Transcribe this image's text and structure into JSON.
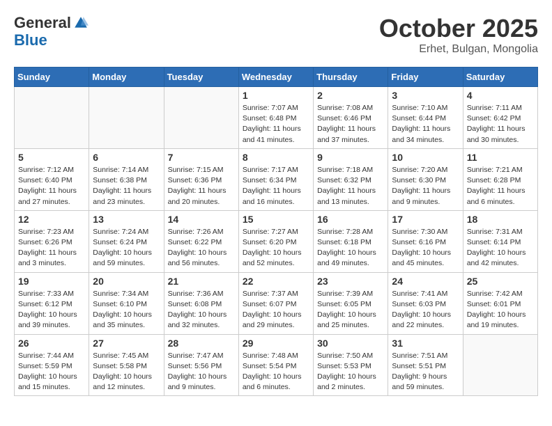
{
  "header": {
    "logo_line1": "General",
    "logo_line2": "Blue",
    "month_title": "October 2025",
    "location": "Erhet, Bulgan, Mongolia"
  },
  "weekdays": [
    "Sunday",
    "Monday",
    "Tuesday",
    "Wednesday",
    "Thursday",
    "Friday",
    "Saturday"
  ],
  "weeks": [
    [
      {
        "day": "",
        "info": ""
      },
      {
        "day": "",
        "info": ""
      },
      {
        "day": "",
        "info": ""
      },
      {
        "day": "1",
        "info": "Sunrise: 7:07 AM\nSunset: 6:48 PM\nDaylight: 11 hours\nand 41 minutes."
      },
      {
        "day": "2",
        "info": "Sunrise: 7:08 AM\nSunset: 6:46 PM\nDaylight: 11 hours\nand 37 minutes."
      },
      {
        "day": "3",
        "info": "Sunrise: 7:10 AM\nSunset: 6:44 PM\nDaylight: 11 hours\nand 34 minutes."
      },
      {
        "day": "4",
        "info": "Sunrise: 7:11 AM\nSunset: 6:42 PM\nDaylight: 11 hours\nand 30 minutes."
      }
    ],
    [
      {
        "day": "5",
        "info": "Sunrise: 7:12 AM\nSunset: 6:40 PM\nDaylight: 11 hours\nand 27 minutes."
      },
      {
        "day": "6",
        "info": "Sunrise: 7:14 AM\nSunset: 6:38 PM\nDaylight: 11 hours\nand 23 minutes."
      },
      {
        "day": "7",
        "info": "Sunrise: 7:15 AM\nSunset: 6:36 PM\nDaylight: 11 hours\nand 20 minutes."
      },
      {
        "day": "8",
        "info": "Sunrise: 7:17 AM\nSunset: 6:34 PM\nDaylight: 11 hours\nand 16 minutes."
      },
      {
        "day": "9",
        "info": "Sunrise: 7:18 AM\nSunset: 6:32 PM\nDaylight: 11 hours\nand 13 minutes."
      },
      {
        "day": "10",
        "info": "Sunrise: 7:20 AM\nSunset: 6:30 PM\nDaylight: 11 hours\nand 9 minutes."
      },
      {
        "day": "11",
        "info": "Sunrise: 7:21 AM\nSunset: 6:28 PM\nDaylight: 11 hours\nand 6 minutes."
      }
    ],
    [
      {
        "day": "12",
        "info": "Sunrise: 7:23 AM\nSunset: 6:26 PM\nDaylight: 11 hours\nand 3 minutes."
      },
      {
        "day": "13",
        "info": "Sunrise: 7:24 AM\nSunset: 6:24 PM\nDaylight: 10 hours\nand 59 minutes."
      },
      {
        "day": "14",
        "info": "Sunrise: 7:26 AM\nSunset: 6:22 PM\nDaylight: 10 hours\nand 56 minutes."
      },
      {
        "day": "15",
        "info": "Sunrise: 7:27 AM\nSunset: 6:20 PM\nDaylight: 10 hours\nand 52 minutes."
      },
      {
        "day": "16",
        "info": "Sunrise: 7:28 AM\nSunset: 6:18 PM\nDaylight: 10 hours\nand 49 minutes."
      },
      {
        "day": "17",
        "info": "Sunrise: 7:30 AM\nSunset: 6:16 PM\nDaylight: 10 hours\nand 45 minutes."
      },
      {
        "day": "18",
        "info": "Sunrise: 7:31 AM\nSunset: 6:14 PM\nDaylight: 10 hours\nand 42 minutes."
      }
    ],
    [
      {
        "day": "19",
        "info": "Sunrise: 7:33 AM\nSunset: 6:12 PM\nDaylight: 10 hours\nand 39 minutes."
      },
      {
        "day": "20",
        "info": "Sunrise: 7:34 AM\nSunset: 6:10 PM\nDaylight: 10 hours\nand 35 minutes."
      },
      {
        "day": "21",
        "info": "Sunrise: 7:36 AM\nSunset: 6:08 PM\nDaylight: 10 hours\nand 32 minutes."
      },
      {
        "day": "22",
        "info": "Sunrise: 7:37 AM\nSunset: 6:07 PM\nDaylight: 10 hours\nand 29 minutes."
      },
      {
        "day": "23",
        "info": "Sunrise: 7:39 AM\nSunset: 6:05 PM\nDaylight: 10 hours\nand 25 minutes."
      },
      {
        "day": "24",
        "info": "Sunrise: 7:41 AM\nSunset: 6:03 PM\nDaylight: 10 hours\nand 22 minutes."
      },
      {
        "day": "25",
        "info": "Sunrise: 7:42 AM\nSunset: 6:01 PM\nDaylight: 10 hours\nand 19 minutes."
      }
    ],
    [
      {
        "day": "26",
        "info": "Sunrise: 7:44 AM\nSunset: 5:59 PM\nDaylight: 10 hours\nand 15 minutes."
      },
      {
        "day": "27",
        "info": "Sunrise: 7:45 AM\nSunset: 5:58 PM\nDaylight: 10 hours\nand 12 minutes."
      },
      {
        "day": "28",
        "info": "Sunrise: 7:47 AM\nSunset: 5:56 PM\nDaylight: 10 hours\nand 9 minutes."
      },
      {
        "day": "29",
        "info": "Sunrise: 7:48 AM\nSunset: 5:54 PM\nDaylight: 10 hours\nand 6 minutes."
      },
      {
        "day": "30",
        "info": "Sunrise: 7:50 AM\nSunset: 5:53 PM\nDaylight: 10 hours\nand 2 minutes."
      },
      {
        "day": "31",
        "info": "Sunrise: 7:51 AM\nSunset: 5:51 PM\nDaylight: 9 hours\nand 59 minutes."
      },
      {
        "day": "",
        "info": ""
      }
    ]
  ]
}
